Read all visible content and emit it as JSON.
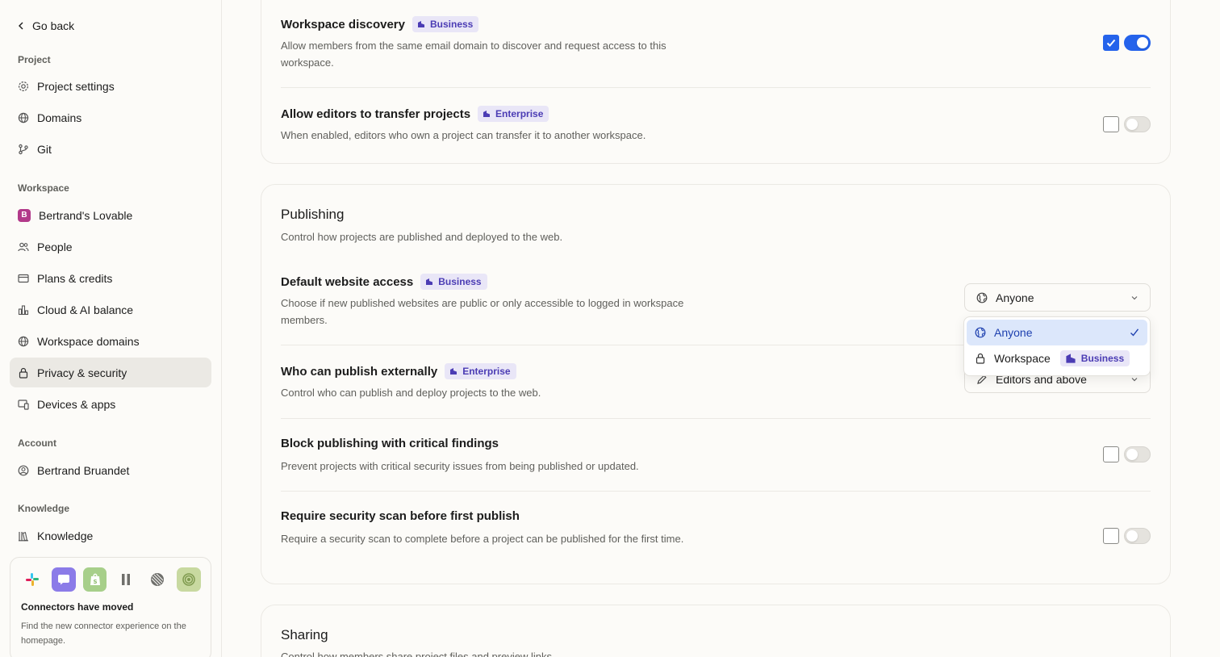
{
  "sidebar": {
    "go_back": "Go back",
    "sections": {
      "project": "Project",
      "workspace": "Workspace",
      "account": "Account",
      "knowledge": "Knowledge"
    },
    "items": {
      "project_settings": "Project settings",
      "domains": "Domains",
      "git": "Git",
      "workspace_name": "Bertrand's Lovable",
      "workspace_initial": "B",
      "people": "People",
      "plans_credits": "Plans & credits",
      "cloud_ai_balance": "Cloud & AI balance",
      "workspace_domains": "Workspace domains",
      "privacy_security": "Privacy & security",
      "devices_apps": "Devices & apps",
      "user_name": "Bertrand Bruandet",
      "knowledge": "Knowledge"
    },
    "connectors": {
      "title": "Connectors have moved",
      "text": "Find the new connector experience on the homepage.",
      "icons": [
        "slack-icon",
        "chat-app-icon",
        "shopify-icon",
        "linear-icon",
        "globe-stripes-icon",
        "spiral-icon"
      ]
    }
  },
  "settings": {
    "workspace_discovery": {
      "title": "Workspace discovery",
      "badge": "Business",
      "desc": "Allow members from the same email domain to discover and request access to this workspace.",
      "checked": true,
      "enabled": true
    },
    "transfer_projects": {
      "title": "Allow editors to transfer projects",
      "badge": "Enterprise",
      "desc": "When enabled, editors who own a project can transfer it to another workspace.",
      "checked": false,
      "enabled": false
    }
  },
  "publishing": {
    "title": "Publishing",
    "desc": "Control how projects are published and deployed to the web.",
    "default_access": {
      "title": "Default website access",
      "badge": "Business",
      "desc": "Choose if new published websites are public or only accessible to logged in workspace members.",
      "value": "Anyone",
      "options": [
        {
          "label": "Anyone",
          "selected": true
        },
        {
          "label": "Workspace",
          "badge": "Business",
          "selected": false
        }
      ]
    },
    "publish_externally": {
      "title": "Who can publish externally",
      "badge": "Enterprise",
      "desc": "Control who can publish and deploy projects to the web.",
      "value": "Editors and above"
    },
    "block_critical": {
      "title": "Block publishing with critical findings",
      "desc": "Prevent projects with critical security issues from being published or updated.",
      "checked": false,
      "enabled": false
    },
    "require_scan": {
      "title": "Require security scan before first publish",
      "desc": "Require a security scan to complete before a project can be published for the first time.",
      "checked": false,
      "enabled": false
    }
  },
  "sharing": {
    "title": "Sharing",
    "desc": "Control how members share project files and preview links."
  },
  "colors": {
    "accent": "#2563eb",
    "badge_bg": "#e9e6f7",
    "badge_text": "#4b3cb4",
    "active_nav": "#ebe9e4",
    "workspace_avatar": "#b23a8a"
  }
}
